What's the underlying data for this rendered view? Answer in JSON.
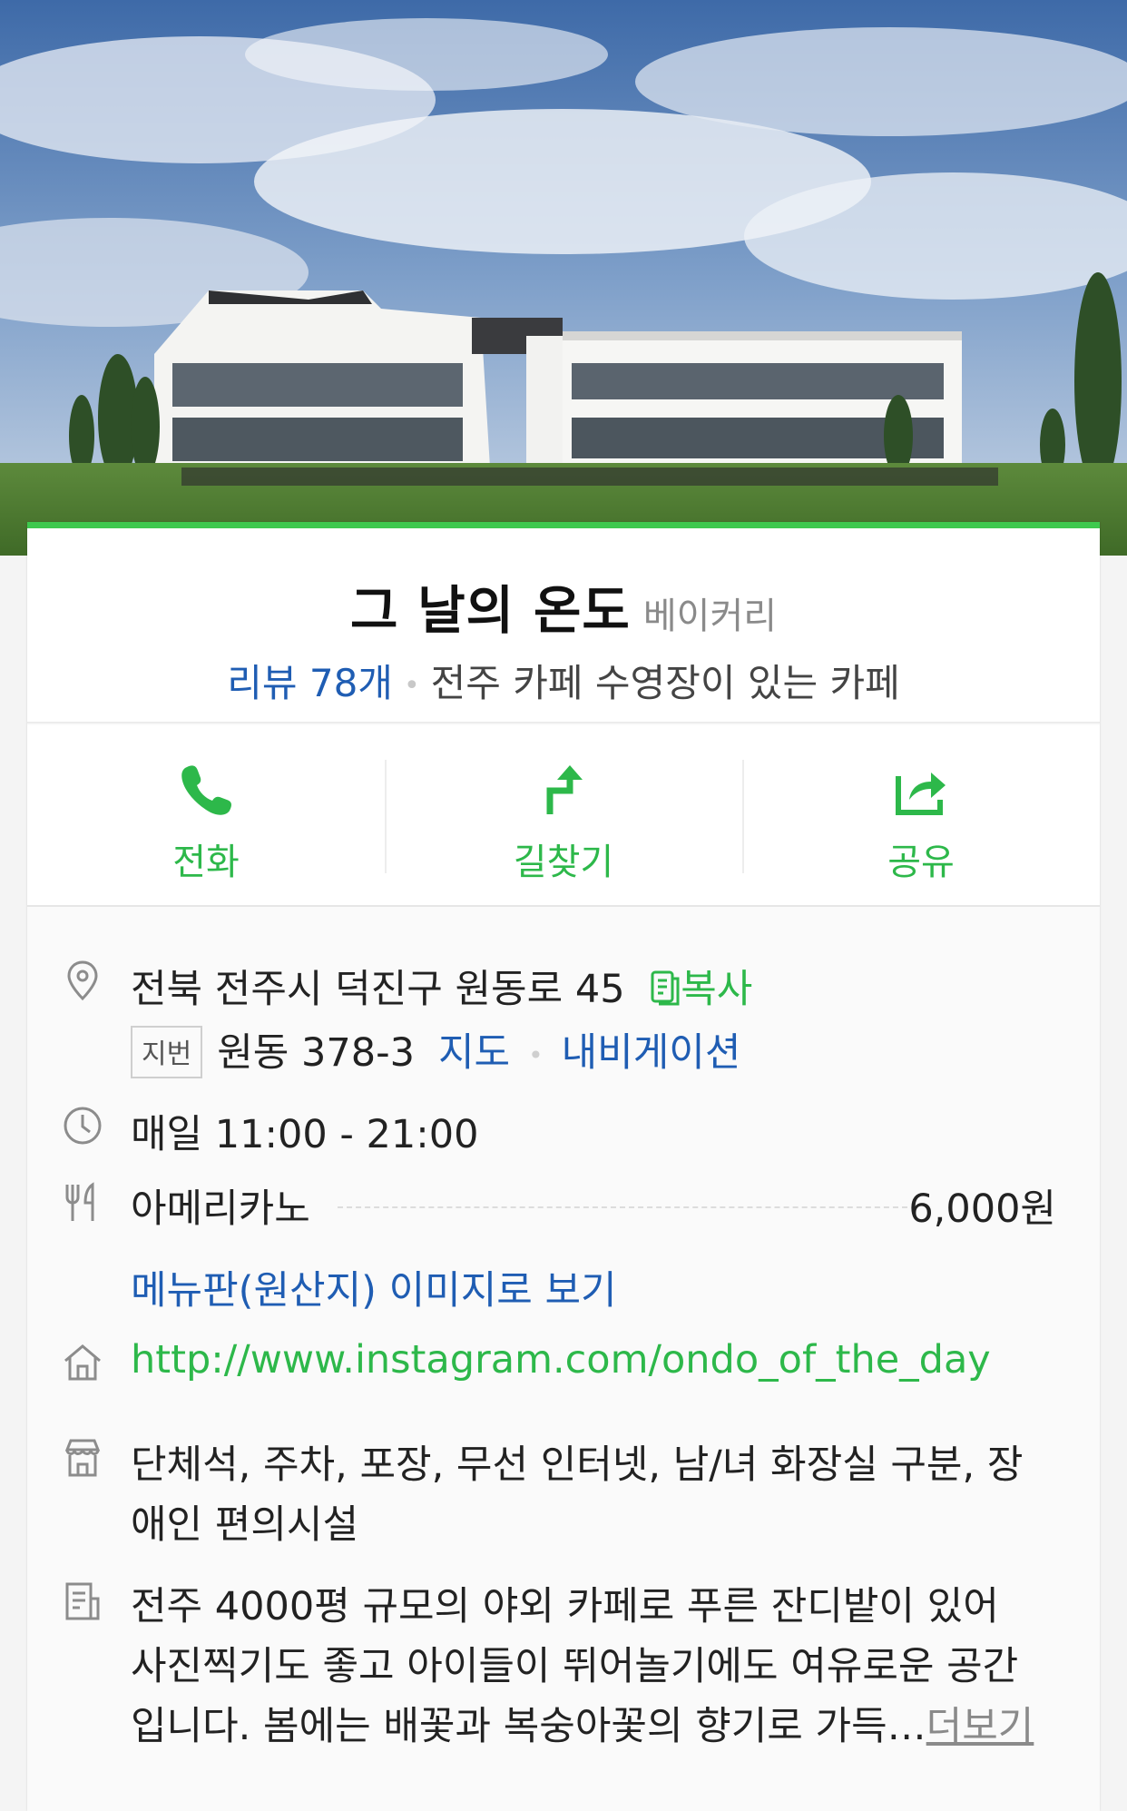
{
  "place": {
    "name": "그 날의 온도",
    "category": "베이커리",
    "review_label": "리뷰 78개",
    "tagline": "전주 카페 수영장이 있는 카페"
  },
  "actions": [
    {
      "label": "전화",
      "icon": "phone-icon"
    },
    {
      "label": "길찾기",
      "icon": "directions-icon"
    },
    {
      "label": "공유",
      "icon": "share-icon"
    }
  ],
  "info": {
    "address": "전북 전주시 덕진구 원동로 45",
    "copy_label": "복사",
    "jibun_badge": "지번",
    "jibun_address": "원동 378-3",
    "map_link": "지도",
    "navigation_link": "내비게이션",
    "hours": "매일 11:00 - 21:00",
    "menu_item": "아메리카노",
    "menu_price": "6,000원",
    "menu_image_link": "메뉴판(원산지) 이미지로 보기",
    "homepage": "http://www.instagram.com/ondo_of_the_day",
    "facilities_line1": "단체석, 주차, 포장, 무선 인터넷, 남/녀 화장실 구분, 장",
    "facilities_line2": "애인 편의시설",
    "description_line1": "전주 4000평 규모의 야외 카페로 푸른 잔디밭이 있어",
    "description_line2": "사진찍기도 좋고 아이들이 뛰어놀기에도 여유로운 공간",
    "description_line3": "입니다. 봄에는 배꽃과 복숭아꽃의 향기로 가득…",
    "more_link": "더보기"
  },
  "colors": {
    "accent_green": "#2db84a",
    "link_blue": "#1f5db3"
  }
}
